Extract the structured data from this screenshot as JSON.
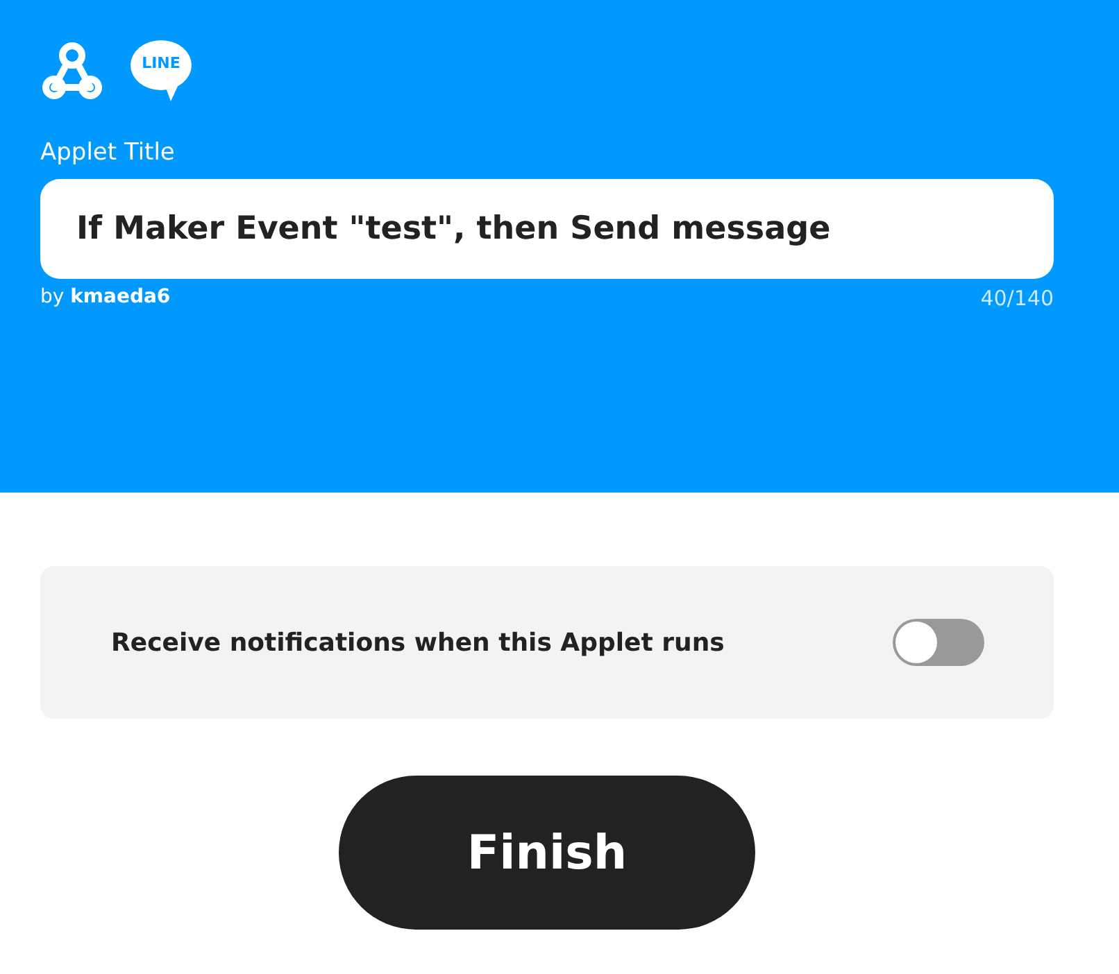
{
  "header": {
    "logo_text": "LINE",
    "label": "Applet Title",
    "title_value": "If Maker Event \"test\", then Send message",
    "author": "by **kmaeda6**",
    "count": "40/140"
  },
  "notifications": {
    "label": "Receive notifications when this Applet runs",
    "on": false
  },
  "finish_button": "Finish"
}
